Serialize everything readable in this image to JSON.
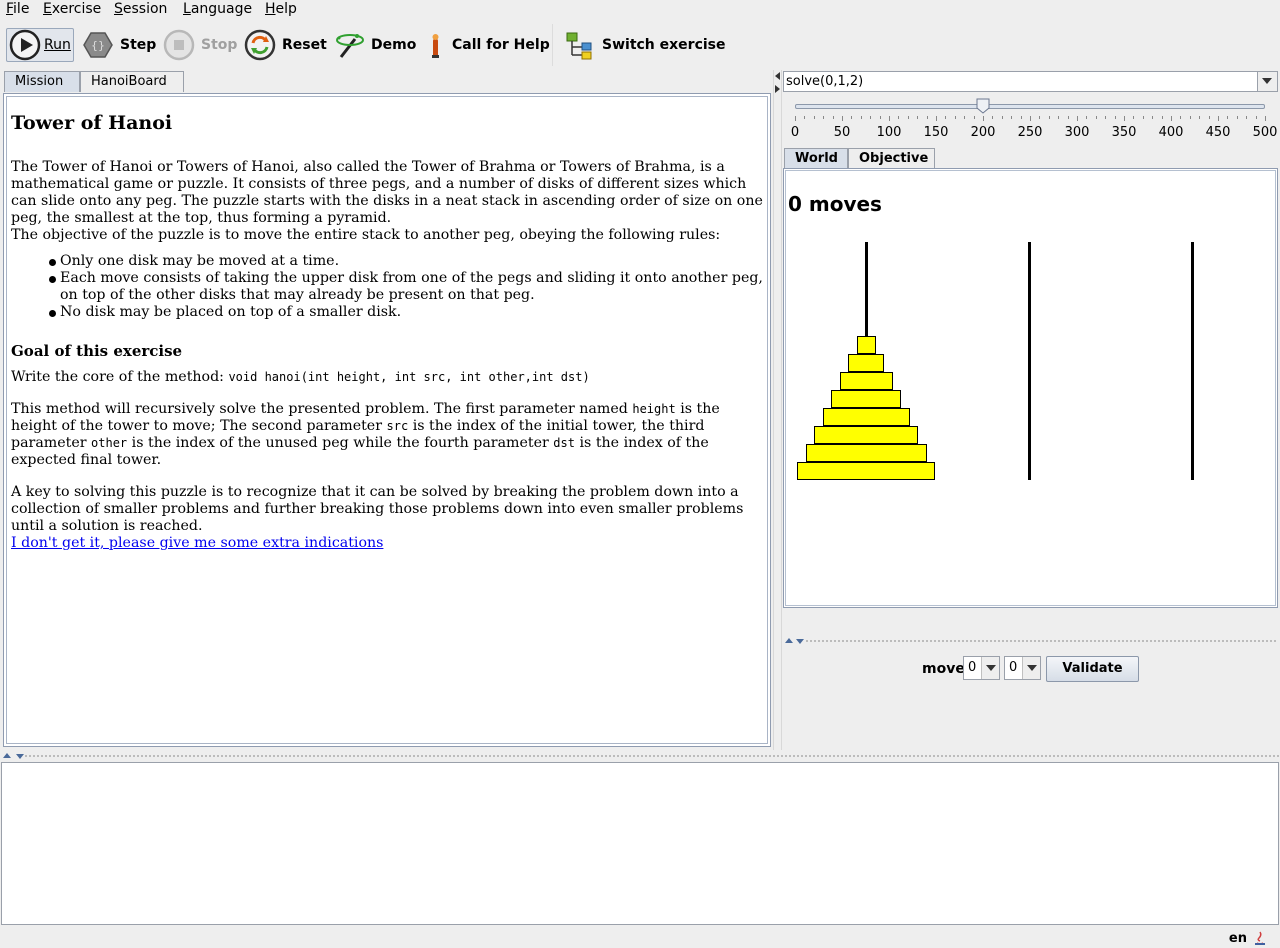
{
  "menubar": {
    "items": [
      {
        "mnemonic": "F",
        "rest": "ile"
      },
      {
        "mnemonic": "E",
        "rest": "xercise"
      },
      {
        "mnemonic": "S",
        "rest": "ession"
      },
      {
        "mnemonic": "L",
        "rest": "anguage"
      },
      {
        "mnemonic": "H",
        "rest": "elp"
      }
    ]
  },
  "toolbar": {
    "run_label": "Run",
    "step_label": "Step",
    "stop_label": "Stop",
    "reset_label": "Reset",
    "demo_label": "Demo",
    "help_label": "Call for Help",
    "switch_label": "Switch exercise"
  },
  "left_tabs": [
    "Mission",
    "HanoiBoard"
  ],
  "mission": {
    "title": "Tower of Hanoi",
    "intro": "The Tower of Hanoi or Towers of Hanoi, also called the Tower of Brahma or Towers of Brahma, is a mathematical game or puzzle. It consists of three pegs, and a number of disks of different sizes which can slide onto any peg. The puzzle starts with the disks in a neat stack in ascending order of size on one peg, the smallest at the top, thus forming a pyramid.",
    "objective": "The objective of the puzzle is to move the entire stack to another peg, obeying the following rules:",
    "rules": [
      "Only one disk may be moved at a time.",
      "Each move consists of taking the upper disk from one of the pegs and sliding it onto another peg, on top of the other disks that may already be present on that peg.",
      "No disk may be placed on top of a smaller disk."
    ],
    "goal_heading": "Goal of this exercise",
    "goal_text": "Write the core of the method: ",
    "goal_code": "void hanoi(int height, int src, int other,int dst)",
    "param_1": "This method will recursively solve the presented problem. The first parameter named ",
    "param_code_height": "height",
    "param_2": " is the height of the tower to move; The second parameter ",
    "param_code_src": "src",
    "param_3": " is the index of the initial tower, the third parameter ",
    "param_code_other": "other",
    "param_4": " is the index of the unused peg while the fourth parameter ",
    "param_code_dst": "dst",
    "param_5": " is the index of the expected final tower.",
    "key_text": "A key to solving this puzzle is to recognize that it can be solved by breaking the problem down into a collection of smaller problems and further breaking those problems down into even smaller problems until a solution is reached.",
    "hint_link": "I don't get it, please give me some extra indications"
  },
  "entity_selector": {
    "value": "solve(0,1,2)"
  },
  "speed_slider": {
    "min": 0,
    "max": 500,
    "value": 200,
    "tick_labels": [
      "0",
      "50",
      "100",
      "150",
      "200",
      "250",
      "300",
      "350",
      "400",
      "450",
      "500"
    ]
  },
  "right_tabs": [
    "World",
    "Objective"
  ],
  "world": {
    "moves_label": "0 moves",
    "pegs": [
      {
        "disks": [
          8,
          7,
          6,
          5,
          4,
          3,
          2,
          1
        ]
      },
      {
        "disks": []
      },
      {
        "disks": []
      }
    ],
    "disk_color": "#ffff00"
  },
  "move_controls": {
    "label": "move",
    "from_value": "0",
    "to_value": "0",
    "validate_label": "Validate"
  },
  "status": {
    "language": "en"
  }
}
